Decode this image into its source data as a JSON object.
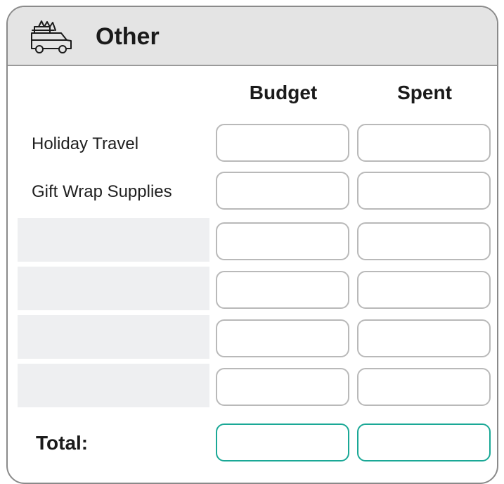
{
  "section": {
    "title": "Other",
    "icon": "car-with-gifts-icon"
  },
  "columns": {
    "budget": "Budget",
    "spent": "Spent"
  },
  "rows": [
    {
      "label": "Holiday Travel",
      "budget": "",
      "spent": ""
    },
    {
      "label": "Gift Wrap Supplies",
      "budget": "",
      "spent": ""
    },
    {
      "label": "",
      "budget": "",
      "spent": ""
    },
    {
      "label": "",
      "budget": "",
      "spent": ""
    },
    {
      "label": "",
      "budget": "",
      "spent": ""
    },
    {
      "label": "",
      "budget": "",
      "spent": ""
    }
  ],
  "total": {
    "label": "Total:",
    "budget": "",
    "spent": ""
  },
  "colors": {
    "header_bg": "#e4e4e4",
    "border": "#8a8a8a",
    "input_border": "#b9b9b9",
    "total_accent": "#1aa896",
    "shaded_row": "#eeeff1"
  }
}
